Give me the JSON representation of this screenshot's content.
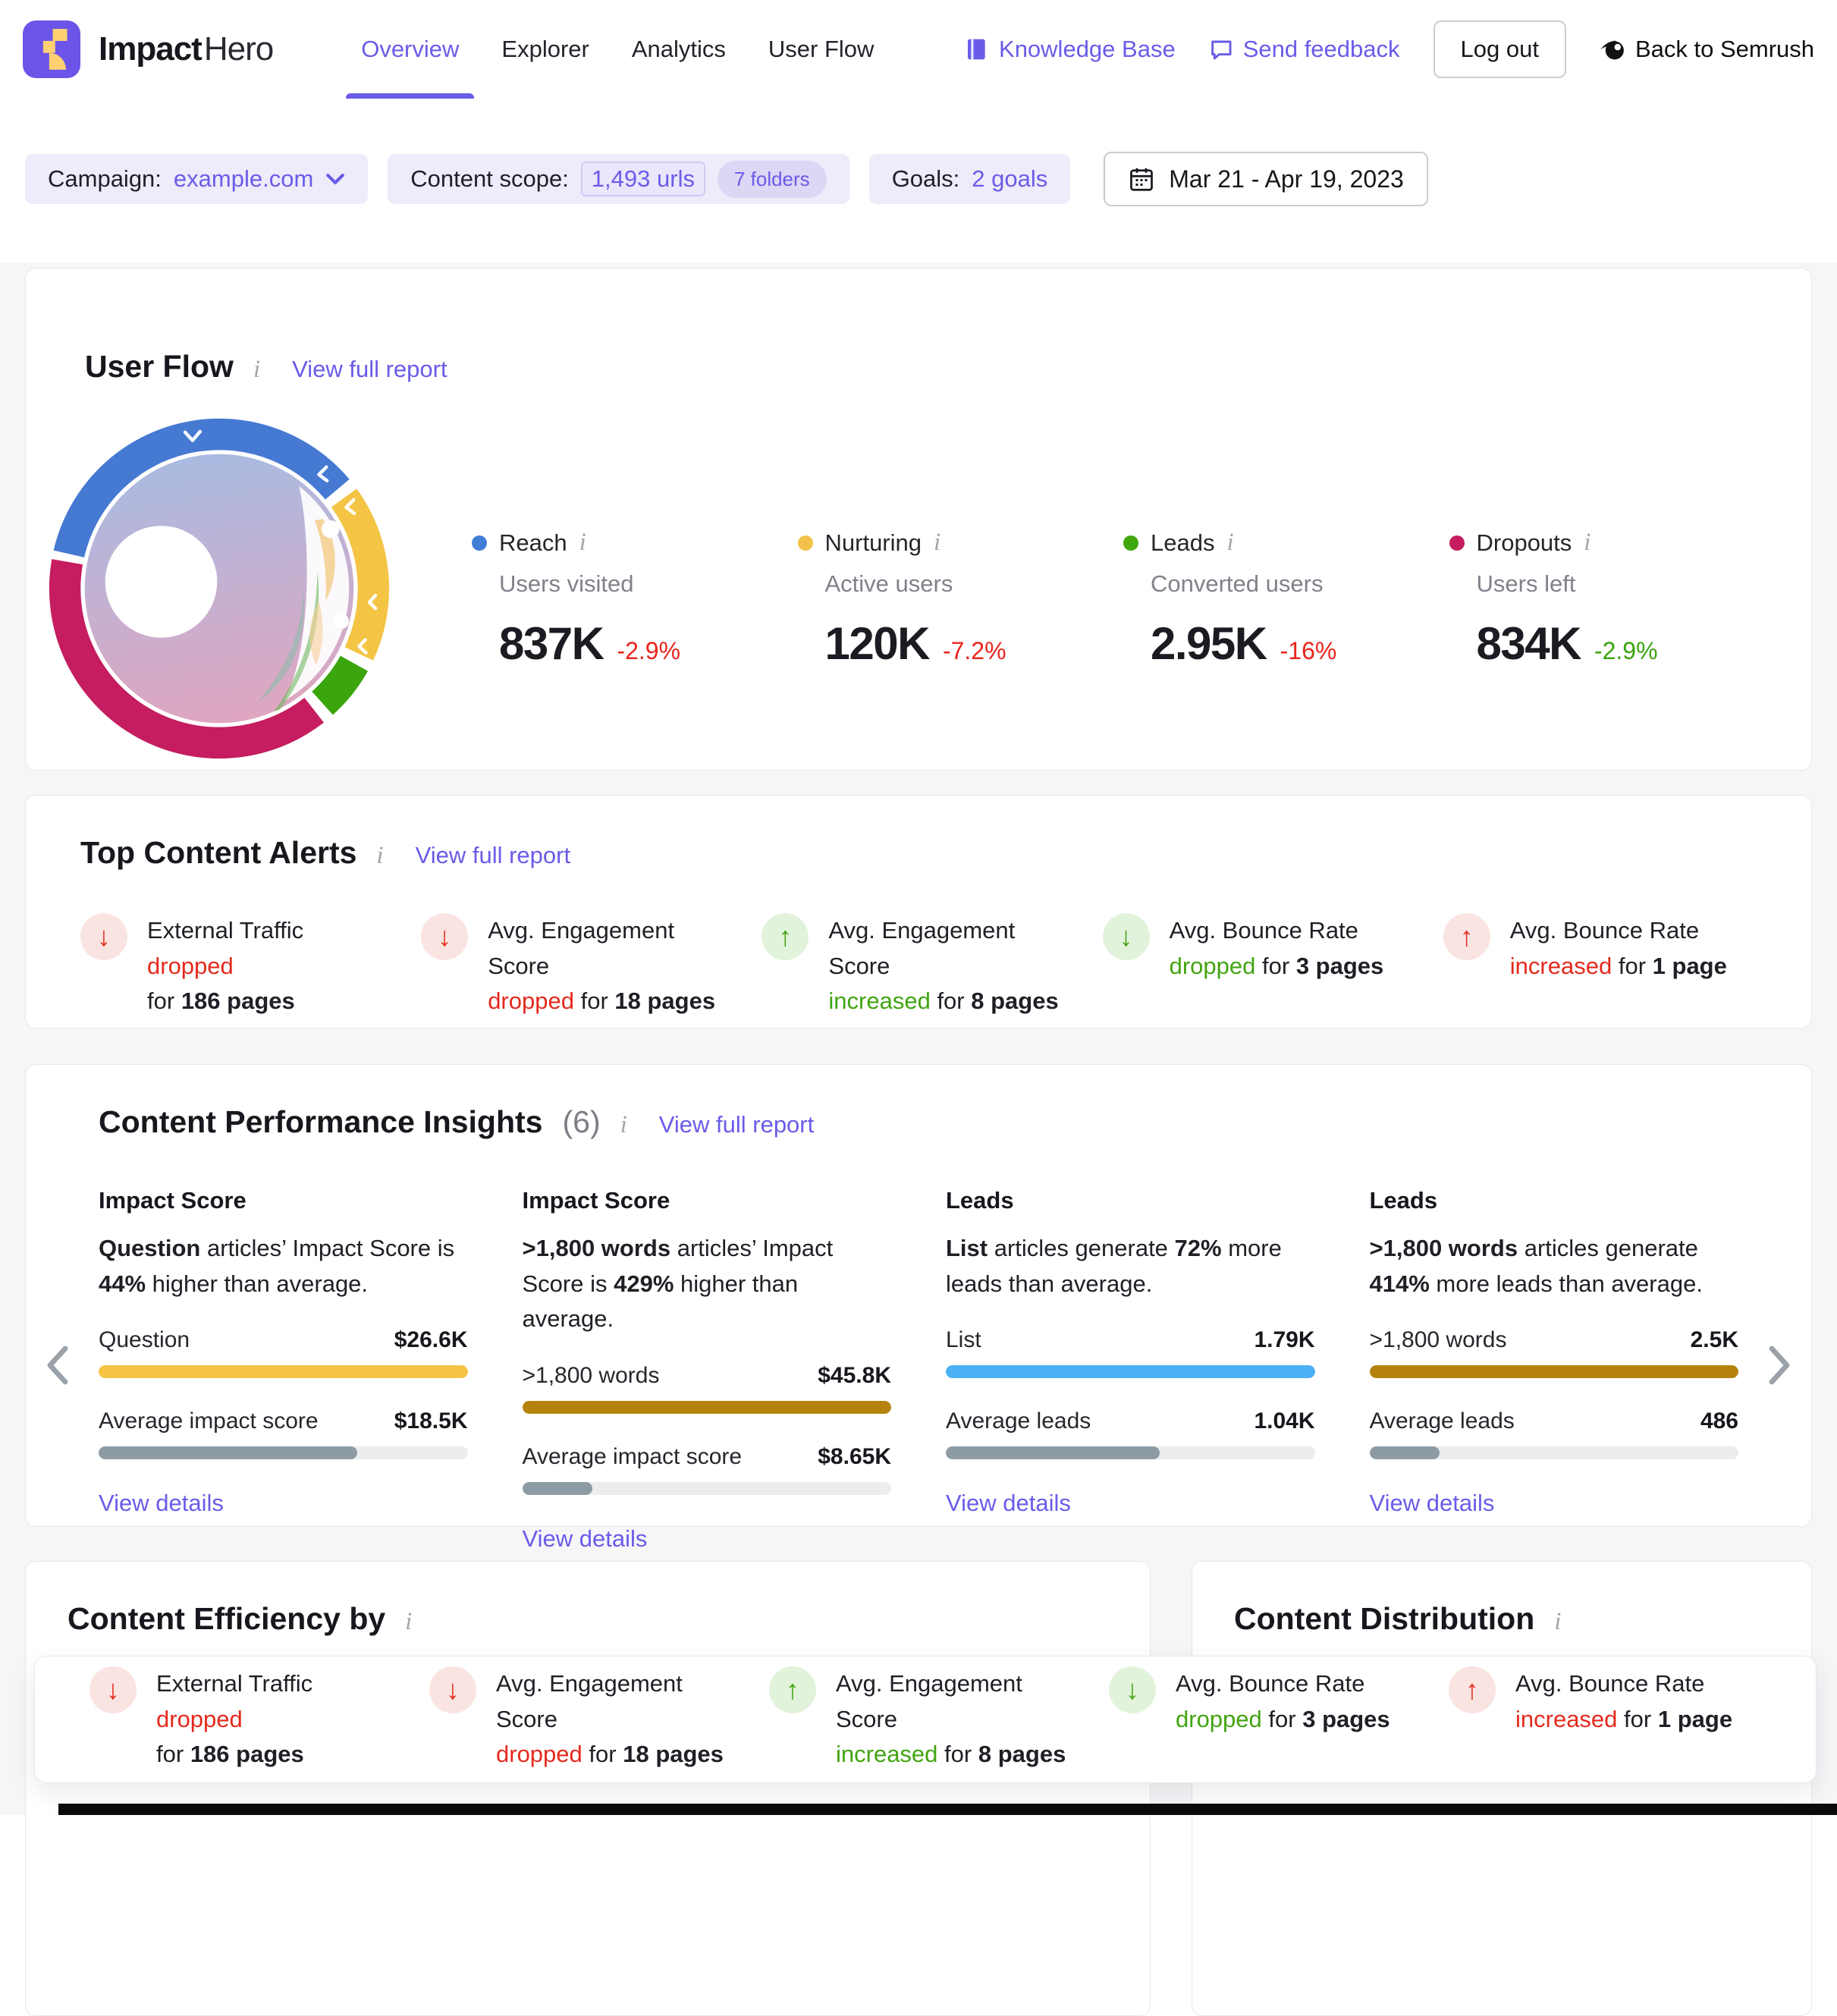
{
  "header": {
    "brand_bold": "Impact",
    "brand_light": "Hero",
    "nav": [
      {
        "label": "Overview",
        "active": "active"
      },
      {
        "label": "Explorer",
        "active": ""
      },
      {
        "label": "Analytics",
        "active": ""
      },
      {
        "label": "User Flow",
        "active": ""
      }
    ],
    "knowledge_base": "Knowledge Base",
    "send_feedback": "Send feedback",
    "logout": "Log out",
    "back_to_semrush": "Back to Semrush"
  },
  "filters": {
    "campaign_label": "Campaign:",
    "campaign_value": "example.com",
    "scope_label": "Content scope:",
    "scope_urls": "1,493 urls",
    "scope_folders": "7 folders",
    "goals_label": "Goals:",
    "goals_value": "2 goals",
    "date_range": "Mar 21 - Apr 19, 2023"
  },
  "user_flow": {
    "title": "User Flow",
    "link": "View full report",
    "metrics": [
      {
        "name": "Reach",
        "dot": "#3f7ed7",
        "label": "Users visited",
        "value": "837K",
        "delta": "-2.9%",
        "tone": "neg"
      },
      {
        "name": "Nurturing",
        "dot": "#f2c24a",
        "label": "Active users",
        "value": "120K",
        "delta": "-7.2%",
        "tone": "neg"
      },
      {
        "name": "Leads",
        "dot": "#3fa60e",
        "label": "Converted users",
        "value": "2.95K",
        "delta": "-16%",
        "tone": "neg"
      },
      {
        "name": "Dropouts",
        "dot": "#c51d5f",
        "label": "Users left",
        "value": "834K",
        "delta": "-2.9%",
        "tone": "pos"
      }
    ]
  },
  "alerts_section": {
    "title": "Top Content Alerts",
    "link": "View full report"
  },
  "alerts": [
    {
      "arrow": "↓",
      "tone": "neg",
      "l1": "External Traffic",
      "l1_status": "dropped",
      "l1_status_tone": "neg-text",
      "l2_status": "",
      "l2_status_tone": "",
      "l2_mid": "for",
      "l2_bold": "186 pages"
    },
    {
      "arrow": "↓",
      "tone": "neg",
      "l1": "Avg. Engagement Score",
      "l1_status": "",
      "l1_status_tone": "",
      "l2_status": "dropped",
      "l2_status_tone": "neg-text",
      "l2_mid": "for",
      "l2_bold": "18 pages"
    },
    {
      "arrow": "↑",
      "tone": "pos",
      "l1": "Avg. Engagement Score",
      "l1_status": "",
      "l1_status_tone": "",
      "l2_status": "increased",
      "l2_status_tone": "pos-text",
      "l2_mid": "for",
      "l2_bold": "8 pages"
    },
    {
      "arrow": "↓",
      "tone": "pos",
      "l1": "Avg. Bounce Rate",
      "l1_status": "",
      "l1_status_tone": "",
      "l2_status": "dropped",
      "l2_status_tone": "pos-text",
      "l2_mid": "for",
      "l2_bold": "3 pages"
    },
    {
      "arrow": "↑",
      "tone": "neg",
      "l1": "Avg. Bounce Rate",
      "l1_status": "",
      "l1_status_tone": "",
      "l2_status": "increased",
      "l2_status_tone": "neg-text",
      "l2_mid": "for",
      "l2_bold": "1 page"
    }
  ],
  "insights": {
    "title": "Content Performance Insights",
    "count": "(6)",
    "link": "View full report",
    "cards": [
      {
        "metric": "Impact Score",
        "d_b1": "Question",
        "d_n1": " articles’ Impact Score is ",
        "d_b2": "44%",
        "d_n2": " higher than average.",
        "bar1_label": "Question",
        "bar1_value": "$26.6K",
        "bar1_color": "#f5c445",
        "bar1_w": "100%",
        "bar2_label": "Average impact score",
        "bar2_value": "$18.5K",
        "bar2_w": "70%",
        "link": "View details"
      },
      {
        "metric": "Impact Score",
        "d_b1": ">1,800 words",
        "d_n1": " articles’ Impact Score is ",
        "d_b2": "429%",
        "d_n2": " higher than average.",
        "bar1_label": ">1,800 words",
        "bar1_value": "$45.8K",
        "bar1_color": "#b5830d",
        "bar1_w": "100%",
        "bar2_label": "Average impact score",
        "bar2_value": "$8.65K",
        "bar2_w": "19%",
        "link": "View details"
      },
      {
        "metric": "Leads",
        "d_b1": "List",
        "d_n1": " articles generate ",
        "d_b2": "72%",
        "d_n2": " more leads than average.",
        "bar1_label": "List",
        "bar1_value": "1.79K",
        "bar1_color": "#4bb0f4",
        "bar1_w": "100%",
        "bar2_label": "Average leads",
        "bar2_value": "1.04K",
        "bar2_w": "58%",
        "link": "View details"
      },
      {
        "metric": "Leads",
        "d_b1": ">1,800 words",
        "d_n1": " articles generate ",
        "d_b2": "414%",
        "d_n2": " more leads than average.",
        "bar1_label": ">1,800 words",
        "bar1_value": "2.5K",
        "bar1_color": "#b5830d",
        "bar1_w": "100%",
        "bar2_label": "Average leads",
        "bar2_value": "486",
        "bar2_w": "19%",
        "link": "View details"
      }
    ]
  },
  "bottom": {
    "left_title": "Content Efficiency by",
    "right_title": "Content Distribution"
  },
  "colors": {
    "accent_purple": "#6a5ce8",
    "ring_blue": "#4679d2",
    "ring_yellow": "#f4c445",
    "ring_green": "#3ba50e",
    "ring_crimson": "#c51d5f",
    "negative_red": "#e42a1d",
    "positive_green": "#42a412"
  }
}
